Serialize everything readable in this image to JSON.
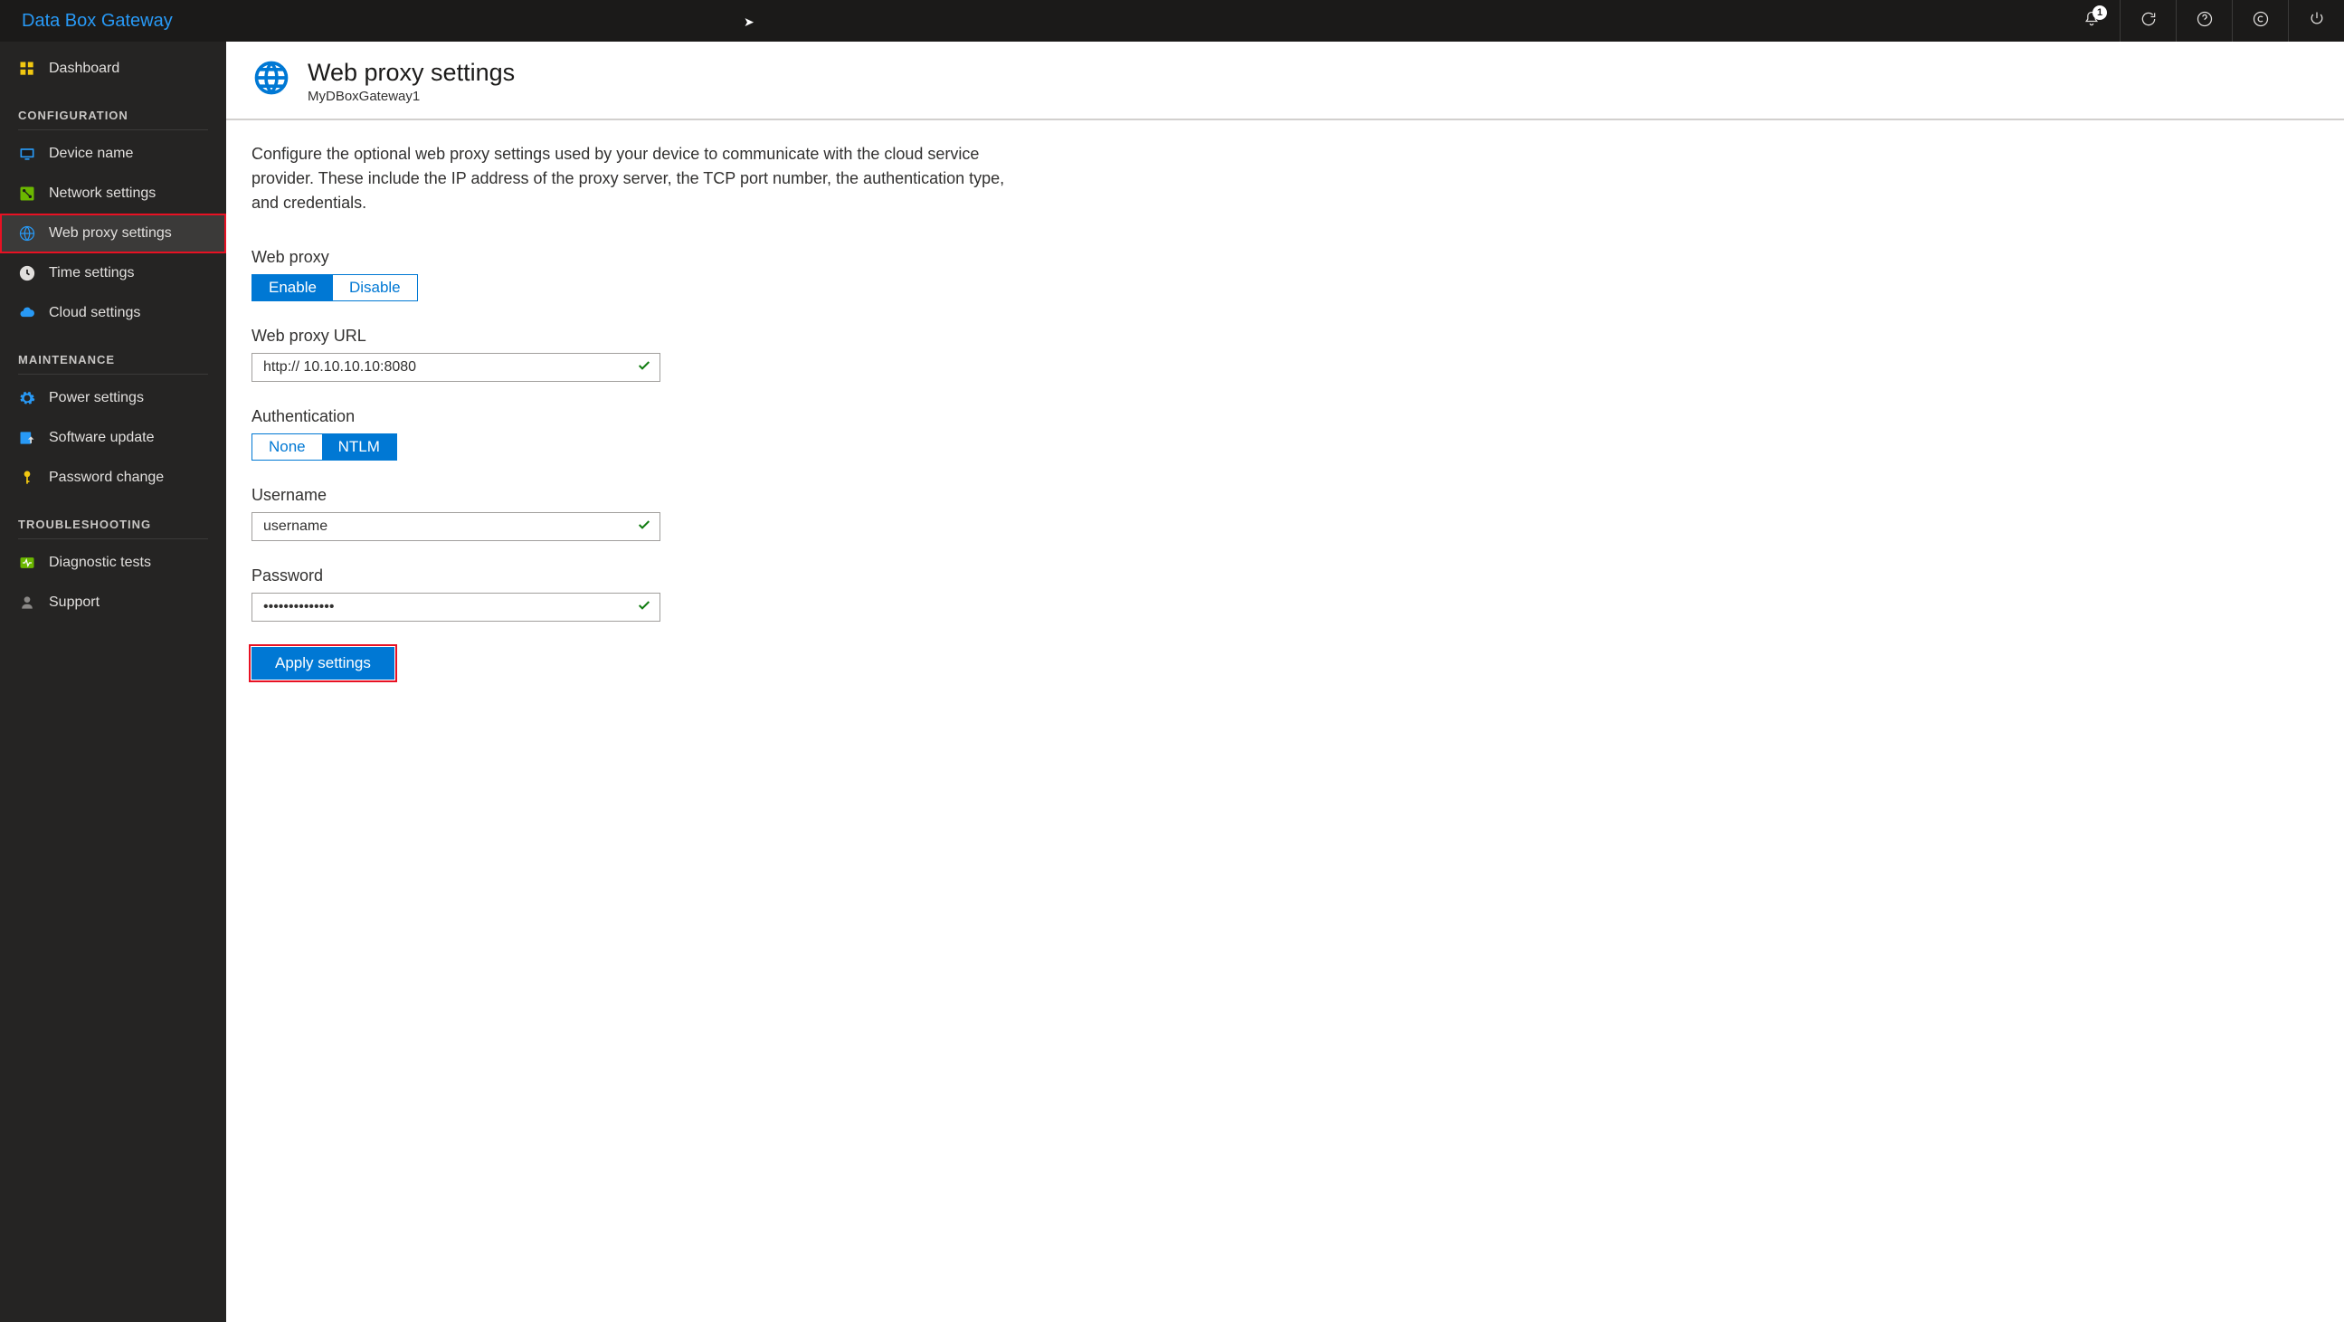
{
  "topbar": {
    "title": "Data Box Gateway",
    "notification_count": "1"
  },
  "sidebar": {
    "dashboard": "Dashboard",
    "section_configuration": "CONFIGURATION",
    "device_name": "Device name",
    "network_settings": "Network settings",
    "web_proxy_settings": "Web proxy settings",
    "time_settings": "Time settings",
    "cloud_settings": "Cloud settings",
    "section_maintenance": "MAINTENANCE",
    "power_settings": "Power settings",
    "software_update": "Software update",
    "password_change": "Password change",
    "section_troubleshooting": "TROUBLESHOOTING",
    "diagnostic_tests": "Diagnostic tests",
    "support": "Support"
  },
  "page": {
    "title": "Web proxy settings",
    "subtitle": "MyDBoxGateway1",
    "description": "Configure the optional web proxy settings used by your device to communicate with the cloud service provider. These include the IP address of the proxy server, the TCP port number, the authentication type, and credentials."
  },
  "form": {
    "web_proxy_label": "Web proxy",
    "enable": "Enable",
    "disable": "Disable",
    "url_label": "Web proxy URL",
    "url_value": "http:// 10.10.10.10:8080",
    "auth_label": "Authentication",
    "auth_none": "None",
    "auth_ntlm": "NTLM",
    "username_label": "Username",
    "username_value": "username",
    "password_label": "Password",
    "password_value": "••••••••••••••",
    "apply_button": "Apply settings"
  }
}
